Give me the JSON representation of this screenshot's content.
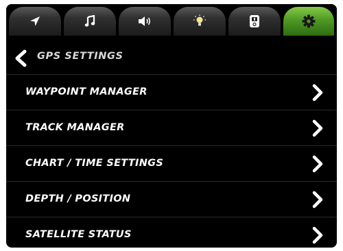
{
  "tabs": [
    {
      "name": "navigation",
      "icon": "navigation-arrow-icon",
      "active": false
    },
    {
      "name": "music",
      "icon": "music-note-icon",
      "active": false
    },
    {
      "name": "volume",
      "icon": "speaker-icon",
      "active": false
    },
    {
      "name": "lighting",
      "icon": "light-bulb-icon",
      "active": false
    },
    {
      "name": "remote",
      "icon": "remote-icon",
      "active": false
    },
    {
      "name": "settings",
      "icon": "gear-icon",
      "active": true
    }
  ],
  "header": {
    "back_icon": "chevron-left-icon",
    "title": "GPS SETTINGS"
  },
  "menu": {
    "items": [
      {
        "label": "WAYPOINT MANAGER",
        "icon": "chevron-right-icon"
      },
      {
        "label": "TRACK MANAGER",
        "icon": "chevron-right-icon"
      },
      {
        "label": "CHART / TIME SETTINGS",
        "icon": "chevron-right-icon"
      },
      {
        "label": "DEPTH / POSITION",
        "icon": "chevron-right-icon"
      },
      {
        "label": "SATELLITE STATUS",
        "icon": "chevron-right-icon"
      }
    ]
  },
  "colors": {
    "background": "#000000",
    "active_tab": "#4f9a24",
    "text": "#ffffff",
    "divider": "#2b2b2b"
  }
}
